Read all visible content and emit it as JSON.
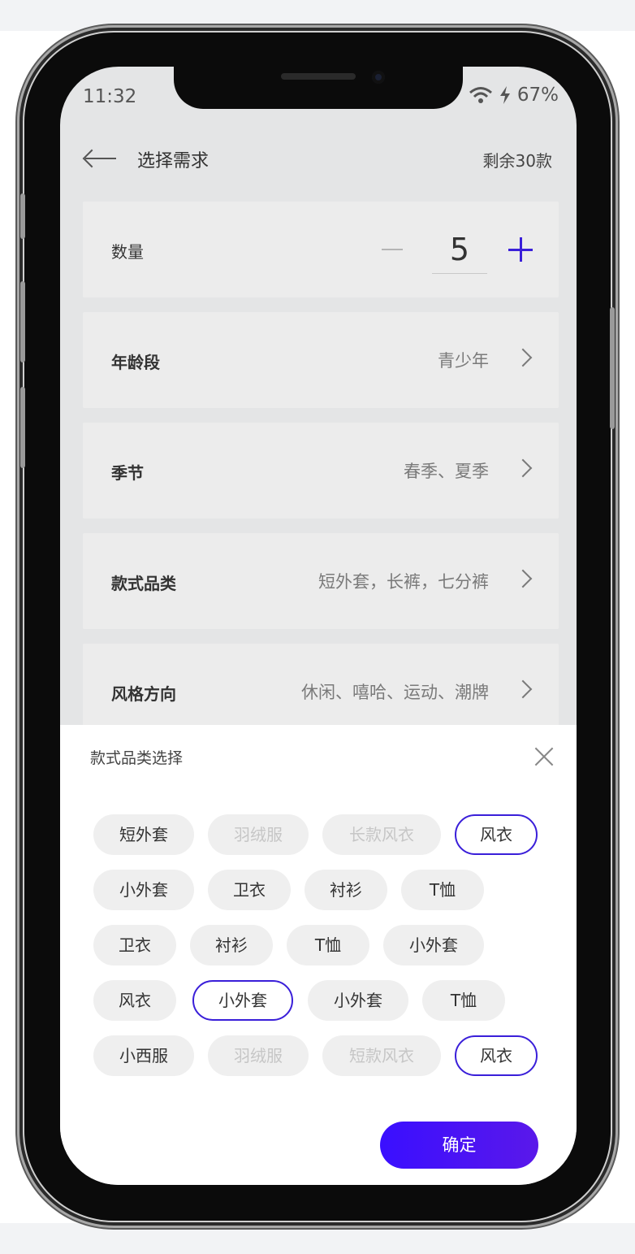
{
  "status_bar": {
    "time": "11:32",
    "battery": "67%"
  },
  "header": {
    "title": "选择需求",
    "remaining": "剩余30款"
  },
  "quantity": {
    "label": "数量",
    "value": "5"
  },
  "rows": [
    {
      "label": "年龄段",
      "value": "青少年"
    },
    {
      "label": "季节",
      "value": "春季、夏季"
    },
    {
      "label": "款式品类",
      "value": "短外套，长裤，七分裤"
    },
    {
      "label": "风格方向",
      "value": "休闲、嘻哈、运动、潮牌"
    }
  ],
  "sheet": {
    "title": "款式品类选择",
    "chips": [
      {
        "label": "短外套",
        "state": "normal"
      },
      {
        "label": "羽绒服",
        "state": "disabled"
      },
      {
        "label": "长款风衣",
        "state": "disabled"
      },
      {
        "label": "风衣",
        "state": "selected"
      },
      {
        "label": "小外套",
        "state": "normal"
      },
      {
        "label": "卫衣",
        "state": "normal"
      },
      {
        "label": "衬衫",
        "state": "normal"
      },
      {
        "label": "T恤",
        "state": "normal"
      },
      {
        "label": "卫衣",
        "state": "normal"
      },
      {
        "label": "衬衫",
        "state": "normal"
      },
      {
        "label": "T恤",
        "state": "normal"
      },
      {
        "label": "小外套",
        "state": "normal"
      },
      {
        "label": "风衣",
        "state": "normal"
      },
      {
        "label": "小外套",
        "state": "selected"
      },
      {
        "label": "小外套",
        "state": "normal"
      },
      {
        "label": "T恤",
        "state": "normal"
      },
      {
        "label": "小西服",
        "state": "normal"
      },
      {
        "label": "羽绒服",
        "state": "disabled"
      },
      {
        "label": "短款风衣",
        "state": "disabled"
      },
      {
        "label": "风衣",
        "state": "selected"
      }
    ],
    "confirm_label": "确定"
  },
  "colors": {
    "accent": "#3a1fd9",
    "button_gradient_start": "#3a0fff",
    "button_gradient_end": "#5a18ea"
  },
  "icons": [
    "back-arrow-icon",
    "wifi-icon",
    "charging-bolt-icon",
    "chevron-right-icon",
    "close-icon",
    "minus-icon",
    "plus-icon"
  ]
}
